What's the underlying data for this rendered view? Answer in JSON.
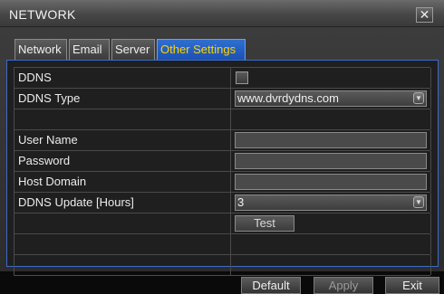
{
  "window": {
    "title": "NETWORK",
    "close_glyph": "✕"
  },
  "tabs": [
    {
      "label": "Network",
      "active": false
    },
    {
      "label": "Email",
      "active": false
    },
    {
      "label": "Server",
      "active": false
    },
    {
      "label": "Other Settings",
      "active": true
    }
  ],
  "rows": {
    "ddns": {
      "label": "DDNS",
      "checked": false
    },
    "ddns_type": {
      "label": "DDNS Type",
      "value": "www.dvrdydns.com"
    },
    "user_name": {
      "label": "User Name",
      "value": ""
    },
    "password": {
      "label": "Password",
      "value": ""
    },
    "host_domain": {
      "label": "Host Domain",
      "value": ""
    },
    "update": {
      "label": "DDNS Update [Hours]",
      "value": "3"
    },
    "test": {
      "label": "Test"
    }
  },
  "footer": {
    "default_label": "Default",
    "apply_label": "Apply",
    "exit_label": "Exit"
  },
  "colors": {
    "active_tab": "#1f5ac0",
    "active_tab_text": "#ffd200",
    "content_border": "#3c6bc8"
  },
  "icons": {
    "dropdown": "chevron-down-icon",
    "close": "close-icon"
  }
}
